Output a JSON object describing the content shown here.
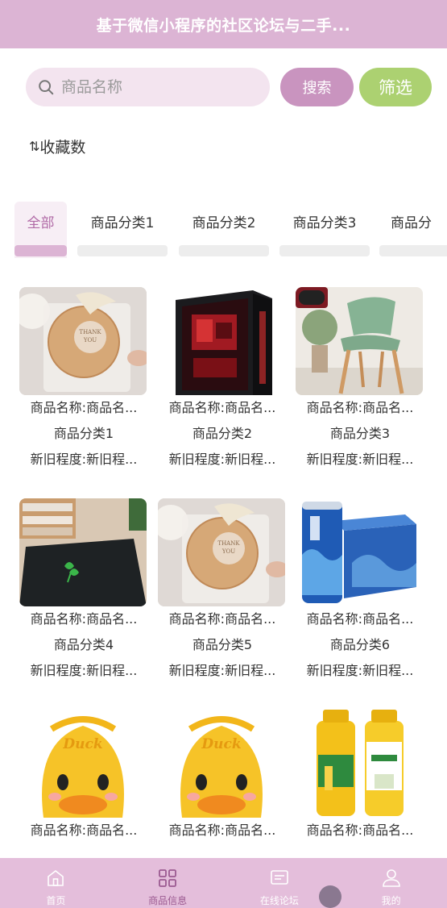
{
  "header": {
    "title": "基于微信小程序的社区论坛与二手..."
  },
  "search": {
    "placeholder": "商品名称",
    "search_label": "搜索",
    "filter_label": "筛选"
  },
  "sort": {
    "icon": "sort-arrows-icon",
    "label": "收藏数"
  },
  "tabs": [
    {
      "label": "全部",
      "active": true
    },
    {
      "label": "商品分类1"
    },
    {
      "label": "商品分类2"
    },
    {
      "label": "商品分类3"
    },
    {
      "label": "商品分"
    }
  ],
  "products": [
    {
      "name": "商品名称:商品名...",
      "category": "商品分类1",
      "condition": "新旧程度:新旧程...",
      "image": "cookie-package"
    },
    {
      "name": "商品名称:商品名...",
      "category": "商品分类2",
      "condition": "新旧程度:新旧程...",
      "image": "pc-case"
    },
    {
      "name": "商品名称:商品名...",
      "category": "商品分类3",
      "condition": "新旧程度:新旧程...",
      "image": "green-chair"
    },
    {
      "name": "商品名称:商品名...",
      "category": "商品分类4",
      "condition": "新旧程度:新旧程...",
      "image": "door-mat"
    },
    {
      "name": "商品名称:商品名...",
      "category": "商品分类5",
      "condition": "新旧程度:新旧程...",
      "image": "cookie-package"
    },
    {
      "name": "商品名称:商品名...",
      "category": "商品分类6",
      "condition": "新旧程度:新旧程...",
      "image": "blue-cans"
    },
    {
      "name": "商品名称:商品名...",
      "category": "",
      "condition": "",
      "image": "duck-backpack"
    },
    {
      "name": "商品名称:商品名...",
      "category": "",
      "condition": "",
      "image": "duck-backpack"
    },
    {
      "name": "商品名称:商品名...",
      "category": "",
      "condition": "",
      "image": "corn-juice"
    }
  ],
  "tabbar": [
    {
      "label": "首页",
      "icon": "home-icon"
    },
    {
      "label": "商品信息",
      "icon": "grid-icon",
      "active": true
    },
    {
      "label": "在线论坛",
      "icon": "forum-icon"
    },
    {
      "label": "我的",
      "icon": "user-icon"
    }
  ],
  "colors": {
    "header": "#dcb4d4",
    "search_btn": "#c994bf",
    "filter_btn": "#acd171",
    "tabbar": "#e4bedb"
  }
}
